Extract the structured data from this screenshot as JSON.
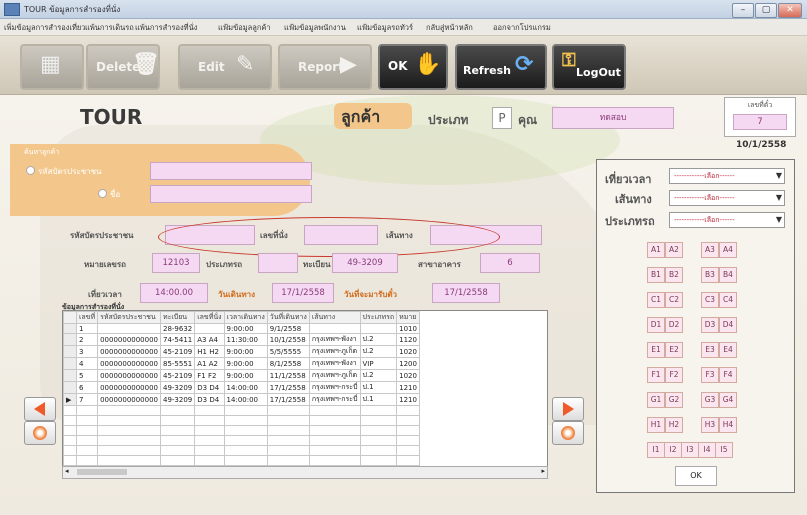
{
  "window": {
    "title": "TOUR  ข้อมูลการสำรองที่นั่ง",
    "min": "–",
    "max": "▢",
    "close": "✕"
  },
  "menu": [
    "เพิ่มข้อมูลการสำรองเที่ยว",
    "แพ้นการเดินรถ",
    "แพ้นการสำรองที่นั่ง",
    "แฟ้มข้อมูลลูกค้า",
    "แฟ้มข้อมูลพนักงาน",
    "แฟ้มข้อมูลรถทัวร์",
    "กลับสู่หน้าหลัก",
    "ออกจากโปรแกรม"
  ],
  "toolbar": {
    "delete": "Delete",
    "edit": "Edit",
    "report": "Report",
    "ok": "OK",
    "refresh": "Refresh",
    "logout": "LogOut",
    "bus_icon": "bus-icon",
    "key_icon": "key-icon"
  },
  "header": {
    "app": "TOUR",
    "customer": "ลูกค้า",
    "type_label": "ประเภท",
    "type_value": "P",
    "name_label": "คุณ",
    "name_value": "ทดสอบ"
  },
  "ticket": {
    "label": "เลขที่ตั๋ว",
    "value": "7",
    "date": "10/1/2558"
  },
  "search": {
    "title": "ค้นหาลูกค้า",
    "opt_id": "รหัสบัตรประชาชน",
    "opt_name": "ชื่อ"
  },
  "form": {
    "id_card_label": "รหัสบัตรประชาชน",
    "seat_label": "เลขที่นั่ง",
    "route_label": "เส้นทาง",
    "bus_no_label": "หมายเลขรถ",
    "bus_no": "12103",
    "bus_type_label": "ประเภทรถ",
    "plate_label": "ทะเบียน",
    "plate": "49-3209",
    "branch_label": "สาขาอาคาร",
    "branch": "6",
    "time_label": "เที่ยวเวลา",
    "time": "14:00.00",
    "travel_date_label": "วันเดินทาง",
    "travel_date": "17/1/2558",
    "pickup_label": "วันที่จะมารับตั๋ว",
    "pickup": "17/1/2558"
  },
  "filters": {
    "time_label": "เที่ยวเวลา",
    "route_label": "เส้นทาง",
    "type_label": "ประเภทรถ",
    "placeholder": "------------เลือก------"
  },
  "seats": [
    [
      "A1",
      "A2",
      "A3",
      "A4"
    ],
    [
      "B1",
      "B2",
      "B3",
      "B4"
    ],
    [
      "C1",
      "C2",
      "C3",
      "C4"
    ],
    [
      "D1",
      "D2",
      "D3",
      "D4"
    ],
    [
      "E1",
      "E2",
      "E3",
      "E4"
    ],
    [
      "F1",
      "F2",
      "F3",
      "F4"
    ],
    [
      "G1",
      "G2",
      "G3",
      "G4"
    ],
    [
      "H1",
      "H2",
      "H3",
      "H4"
    ]
  ],
  "seats_last": [
    "I1",
    "I2",
    "I3",
    "I4",
    "I5"
  ],
  "ok_button": "OK",
  "grid": {
    "title": "ข้อมูลการสำรองที่นั่ง",
    "columns": [
      "เลขที่",
      "รหัสบัตรประชาชน",
      "ทะเบียน",
      "เลขที่นั่ง",
      "เวลาเดินทาง",
      "วันที่เดินทาง",
      "เส้นทาง",
      "ประเภทรถ",
      "หมาย"
    ],
    "rows": [
      [
        "1",
        "",
        "28-9632",
        "",
        "9:00:00",
        "9/1/2558",
        "",
        "",
        "1010"
      ],
      [
        "2",
        "0000000000000",
        "74-5411",
        "A3 A4",
        "11:30:00",
        "10/1/2558",
        "กรุงเทพฯ-พังงา",
        "ป.2",
        "1120"
      ],
      [
        "3",
        "0000000000000",
        "45-2109",
        "H1 H2",
        "9:00:00",
        "5/5/5555",
        "กรุงเทพฯ-ภูเก็ต",
        "ป.2",
        "1020"
      ],
      [
        "4",
        "0000000000000",
        "85-5551",
        "A1 A2",
        "9:00:00",
        "8/1/2558",
        "กรุงเทพฯ-พังงา",
        "VIP",
        "1200"
      ],
      [
        "5",
        "0000000000000",
        "45-2109",
        "F1 F2",
        "9:00:00",
        "11/1/2558",
        "กรุงเทพฯ-ภูเก็ต",
        "ป.2",
        "1020"
      ],
      [
        "6",
        "0000000000000",
        "49-3209",
        "D3 D4",
        "14:00:00",
        "17/1/2558",
        "กรุงเทพฯ-กระบี่",
        "ป.1",
        "1210"
      ],
      [
        "7",
        "0000000000000",
        "49-3209",
        "D3 D4",
        "14:00:00",
        "17/1/2558",
        "กรุงเทพฯ-กระบี่",
        "ป.1",
        "1210"
      ]
    ]
  },
  "nav": {
    "left": "prev",
    "right": "next"
  },
  "colors": {
    "accent": "#ee5a2a",
    "pink": "#f5d8f2",
    "orange": "#f3c78b"
  }
}
